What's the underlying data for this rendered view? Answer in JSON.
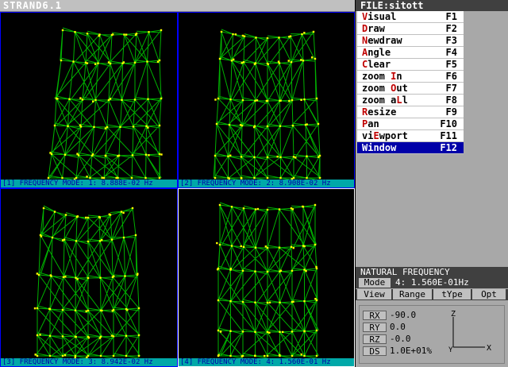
{
  "app": {
    "title": "STRAND6.1"
  },
  "file_bar": {
    "label": "FILE:sitott"
  },
  "menu": [
    {
      "hotkey": "V",
      "rest": "isual",
      "pre": "",
      "key": "F1",
      "selected": false
    },
    {
      "hotkey": "D",
      "rest": "raw",
      "pre": "",
      "key": "F2",
      "selected": false
    },
    {
      "hotkey": "N",
      "rest": "ewdraw",
      "pre": "",
      "key": "F3",
      "selected": false
    },
    {
      "hotkey": "A",
      "rest": "ngle",
      "pre": "",
      "key": "F4",
      "selected": false
    },
    {
      "hotkey": "C",
      "rest": "lear",
      "pre": "",
      "key": "F5",
      "selected": false
    },
    {
      "hotkey": "I",
      "rest": "n",
      "pre": "zoom ",
      "key": "F6",
      "selected": false
    },
    {
      "hotkey": "O",
      "rest": "ut",
      "pre": "zoom ",
      "key": "F7",
      "selected": false
    },
    {
      "hotkey": "L",
      "rest": "l",
      "pre": "zoom a",
      "key": "F8",
      "selected": false
    },
    {
      "hotkey": "R",
      "rest": "esize",
      "pre": "",
      "key": "F9",
      "selected": false
    },
    {
      "hotkey": "P",
      "rest": "an",
      "pre": "",
      "key": "F10",
      "selected": false
    },
    {
      "hotkey": "E",
      "rest": "wport",
      "pre": "vi",
      "key": "F11",
      "selected": false
    },
    {
      "hotkey": "W",
      "rest": "indow",
      "pre": "",
      "key": "F12",
      "selected": true
    }
  ],
  "viewports": [
    {
      "caption": "[1] FREQUENCY MODE: 1: 8.888E-02 Hz",
      "active": false
    },
    {
      "caption": "[2] FREQUENCY MODE: 2: 8.908E-02 Hz",
      "active": false
    },
    {
      "caption": "[3] FREQUENCY MODE: 3: 8.942E-02 Hz",
      "active": false
    },
    {
      "caption": "[4] FREQUENCY MODE: 4: 1.560E-01 Hz",
      "active": true
    }
  ],
  "natural_frequency": {
    "title": "NATURAL FREQUENCY",
    "mode_label": "Mode",
    "mode_value": "4: 1.560E-01Hz"
  },
  "tabs": [
    "View",
    "Range",
    "tYpe",
    "Opt"
  ],
  "view": {
    "rows": [
      {
        "key": "RX",
        "value": "-90.0"
      },
      {
        "key": "RY",
        "value": "0.0"
      },
      {
        "key": "RZ",
        "value": "-0.0"
      },
      {
        "key": "DS",
        "value": "1.0E+01%"
      }
    ],
    "axis": {
      "up": "Z",
      "right": "X",
      "origin": "Y"
    }
  },
  "colors": {
    "structure": "#00b000",
    "nodes": "#ffff00",
    "caption_bg": "#00a8a8",
    "selected_menu": "#0000a8"
  }
}
